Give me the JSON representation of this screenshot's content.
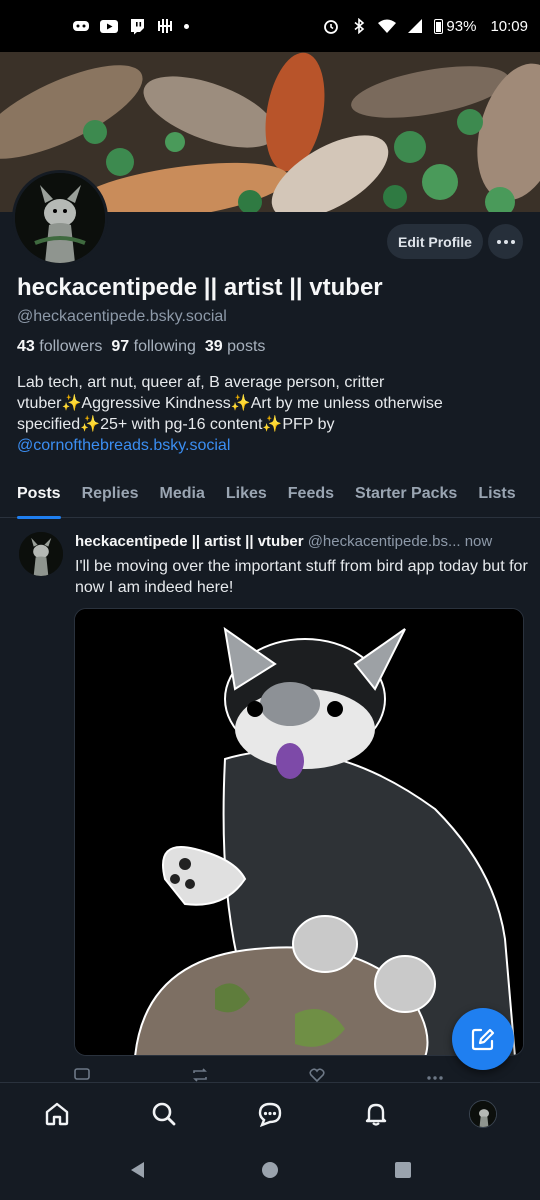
{
  "status_bar": {
    "icons_left": [
      "discord-icon",
      "youtube-icon",
      "twitch-icon",
      "fitness-icon",
      "notification-dot"
    ],
    "icons_right": [
      "alarm-icon",
      "bluetooth-icon",
      "wifi-icon",
      "signal-icon",
      "battery-icon"
    ],
    "battery": "93%",
    "time": "10:09"
  },
  "profile": {
    "edit_label": "Edit Profile",
    "name": "heckacentipede || artist || vtuber",
    "handle": "@heckacentipede.bsky.social",
    "followers_count": "43",
    "followers_label": "followers",
    "following_count": "97",
    "following_label": "following",
    "posts_count": "39",
    "posts_label": "posts",
    "bio_text": "Lab tech, art nut, queer af, B average person, critter vtuber✨Aggressive Kindness✨Art by me unless otherwise specified✨25+ with pg-16 content✨PFP by ",
    "bio_mention": "@cornofthebreads.bsky.social"
  },
  "tabs": [
    "Posts",
    "Replies",
    "Media",
    "Likes",
    "Feeds",
    "Starter Packs",
    "Lists"
  ],
  "post": {
    "author_name": "heckacentipede || artist || vtuber",
    "author_handle": "@heckacentipede.bs...",
    "time": "now",
    "text": "I'll be moving over the important stuff from bird app today but for now I am indeed here!",
    "actions": [
      "reply-icon",
      "repost-icon",
      "like-icon",
      "more-icon"
    ]
  },
  "bottom_nav": [
    "home-icon",
    "search-icon",
    "chat-icon",
    "bell-icon",
    "profile-avatar"
  ],
  "system_nav": [
    "back-icon",
    "home-circle-icon",
    "recents-icon"
  ],
  "colors": {
    "background": "#151b23",
    "accent": "#1f7ff0",
    "mention": "#3b8ef2",
    "muted_text": "#8d99a8"
  }
}
